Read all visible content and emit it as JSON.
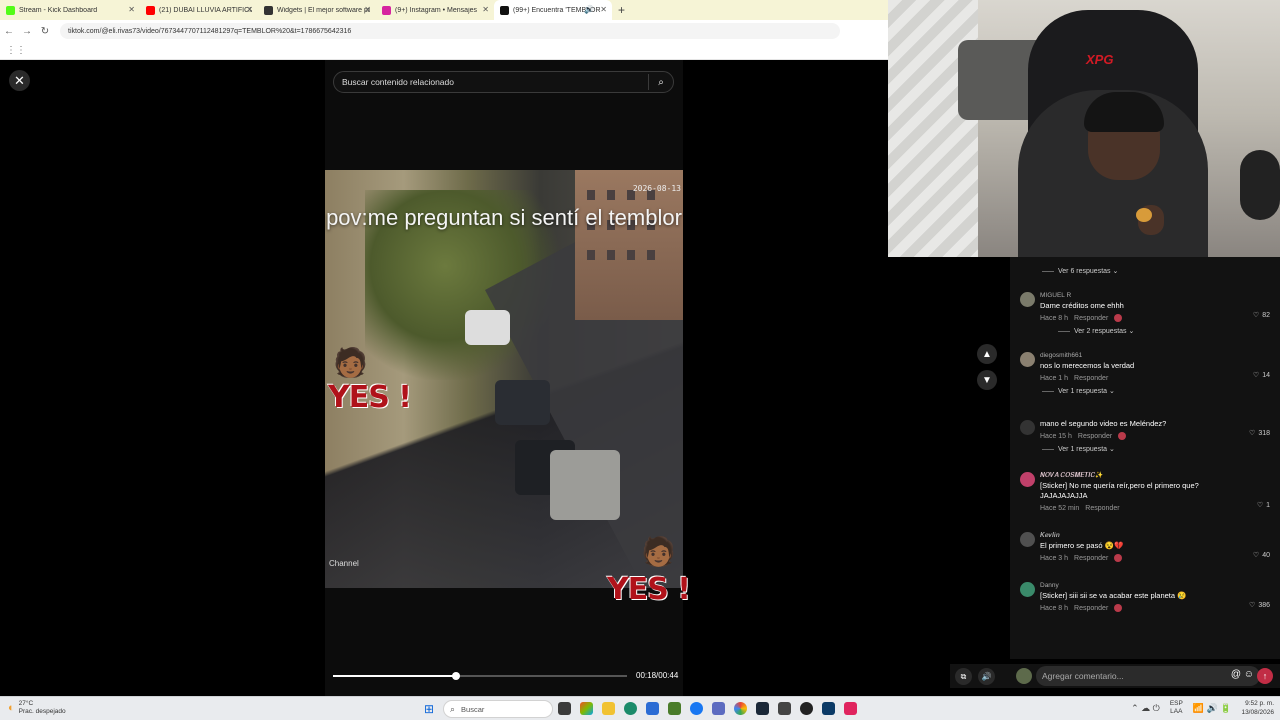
{
  "browser": {
    "tabs": [
      {
        "label": "Stream - Kick Dashboard",
        "icon": "kick-icon",
        "color": "#53fc18",
        "active": false
      },
      {
        "label": "(21) DUBAI LLUVIA ARTIFICIAL",
        "icon": "youtube-icon",
        "color": "#ff0000",
        "active": false
      },
      {
        "label": "Widgets | El mejor software pa",
        "icon": "widgets-icon",
        "color": "#333333",
        "active": false
      },
      {
        "label": "(9+) Instagram • Mensajes",
        "icon": "instagram-icon",
        "color": "#d6249f",
        "active": false
      },
      {
        "label": "(99+) Encuentra 'TEMBLOR",
        "icon": "tiktok-icon",
        "color": "#111111",
        "active": true
      }
    ],
    "url": "tiktok.com/@eli.rivas73/video/7673447707112481297q=TEMBLOR%20&t=1786675642316"
  },
  "player": {
    "close_icon": "close-icon",
    "search_placeholder": "Buscar contenido relacionado",
    "overlay_text": "pov:me preguntan si sentí el temblor",
    "video_timestamp": "2026-08-13",
    "channel_watermark": "Channel",
    "sticker_text": "YES !",
    "progress_fraction": 0.42,
    "time": "00:18/00:44"
  },
  "webcam": {
    "chair_logo": "XPG"
  },
  "comments": {
    "top_replies": "Ver 6 respuestas",
    "items": [
      {
        "user": "MIGUEL R",
        "text": "Dame créditos ome ehhh",
        "time": "Hace 8 h",
        "reply": "Responder",
        "likes": "82",
        "creator_like": true,
        "avatar_color": "#7a7a6a",
        "replies": "Ver 2 respuestas"
      },
      {
        "user": "diegosmith661",
        "text": "nos lo merecemos la verdad",
        "time": "Hace 1 h",
        "reply": "Responder",
        "likes": "14",
        "creator_like": false,
        "avatar_color": "#8a8070",
        "replies": "Ver 1 respuesta"
      },
      {
        "user": "",
        "text": "mano el segundo video es Meléndez?",
        "time": "Hace 15 h",
        "reply": "Responder",
        "likes": "318",
        "creator_like": true,
        "avatar_color": "#333333",
        "replies": "Ver 1 respuesta"
      },
      {
        "user": "𝑵𝑶𝑽𝑨 𝑪𝑶𝑺𝑴𝑬𝑻𝑰𝑪✨",
        "text": "[Sticker] No me quería reír,pero el primero que? JAJAJAJAJJA",
        "time": "Hace 52 min",
        "reply": "Responder",
        "likes": "1",
        "creator_like": false,
        "avatar_color": "#c0406a",
        "replies": ""
      },
      {
        "user": "𝑲𝒆𝒗𝒍𝒊𝒏",
        "text": "El primero se pasó 😵💔",
        "time": "Hace 3 h",
        "reply": "Responder",
        "likes": "40",
        "creator_like": true,
        "avatar_color": "#505050",
        "replies": ""
      },
      {
        "user": "Danny",
        "text": "[Sticker] siii sii se va acabar este planeta 😢",
        "time": "Hace 8 h",
        "reply": "Responder",
        "likes": "386",
        "creator_like": true,
        "avatar_color": "#3a8a6a",
        "replies": ""
      }
    ],
    "input_placeholder": "Agregar comentario..."
  },
  "taskbar": {
    "temperature": "27°C",
    "weather_desc": "Prac. despejado",
    "search_label": "Buscar",
    "lang_top": "ESP",
    "lang_bottom": "LAA",
    "time": "9:52 p. m.",
    "date": "13/08/2026"
  }
}
